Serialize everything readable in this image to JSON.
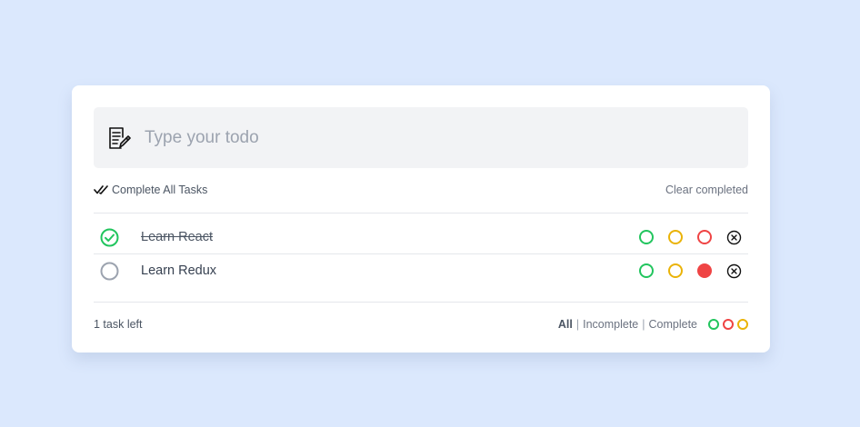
{
  "input": {
    "placeholder": "Type your todo",
    "value": ""
  },
  "toolbar": {
    "complete_all_label": "Complete All Tasks",
    "clear_completed_label": "Clear completed"
  },
  "todos": [
    {
      "text": "Learn React",
      "completed": true,
      "priority_selected": null
    },
    {
      "text": "Learn Redux",
      "completed": false,
      "priority_selected": "red"
    }
  ],
  "footer": {
    "tasks_left": "1 task left",
    "filters": [
      "All",
      "Incomplete",
      "Complete"
    ],
    "active_filter": "All",
    "separator": "|"
  },
  "colors": {
    "background": "#dbe8fd",
    "green": "#22c55e",
    "yellow": "#eab308",
    "red": "#ef4444",
    "gray_check": "#9ca3af"
  },
  "icons": {
    "input": "note-pencil-icon",
    "complete_all": "double-check-icon",
    "completed_check": "check-circle-icon",
    "uncompleted_check": "empty-circle-icon",
    "delete": "cancel-circle-icon"
  }
}
